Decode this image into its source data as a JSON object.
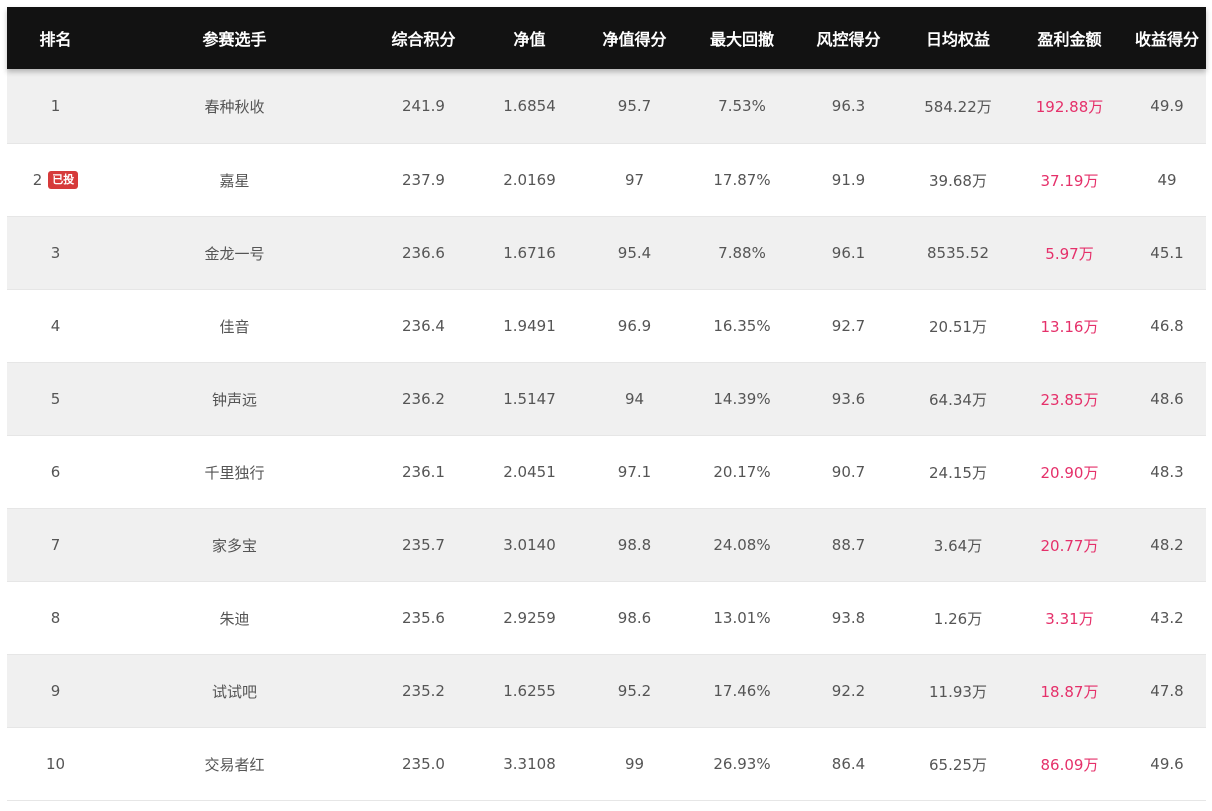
{
  "table": {
    "headers": {
      "rank": "排名",
      "name": "参赛选手",
      "score": "综合积分",
      "nav": "净值",
      "nav_score": "净值得分",
      "max_drawdown": "最大回撤",
      "risk_score": "风控得分",
      "daily_equity": "日均权益",
      "profit": "盈利金额",
      "return_score": "收益得分"
    },
    "rows": [
      {
        "rank": "1",
        "badge": "",
        "name": "春种秋收",
        "score": "241.9",
        "nav": "1.6854",
        "nav_score": "95.7",
        "max_drawdown": "7.53%",
        "risk_score": "96.3",
        "daily_equity": "584.22万",
        "profit": "192.88万",
        "return_score": "49.9"
      },
      {
        "rank": "2",
        "badge": "已投",
        "name": "嘉星",
        "score": "237.9",
        "nav": "2.0169",
        "nav_score": "97",
        "max_drawdown": "17.87%",
        "risk_score": "91.9",
        "daily_equity": "39.68万",
        "profit": "37.19万",
        "return_score": "49"
      },
      {
        "rank": "3",
        "badge": "",
        "name": "金龙一号",
        "score": "236.6",
        "nav": "1.6716",
        "nav_score": "95.4",
        "max_drawdown": "7.88%",
        "risk_score": "96.1",
        "daily_equity": "8535.52",
        "profit": "5.97万",
        "return_score": "45.1"
      },
      {
        "rank": "4",
        "badge": "",
        "name": "佳音",
        "score": "236.4",
        "nav": "1.9491",
        "nav_score": "96.9",
        "max_drawdown": "16.35%",
        "risk_score": "92.7",
        "daily_equity": "20.51万",
        "profit": "13.16万",
        "return_score": "46.8"
      },
      {
        "rank": "5",
        "badge": "",
        "name": "钟声远",
        "score": "236.2",
        "nav": "1.5147",
        "nav_score": "94",
        "max_drawdown": "14.39%",
        "risk_score": "93.6",
        "daily_equity": "64.34万",
        "profit": "23.85万",
        "return_score": "48.6"
      },
      {
        "rank": "6",
        "badge": "",
        "name": "千里独行",
        "score": "236.1",
        "nav": "2.0451",
        "nav_score": "97.1",
        "max_drawdown": "20.17%",
        "risk_score": "90.7",
        "daily_equity": "24.15万",
        "profit": "20.90万",
        "return_score": "48.3"
      },
      {
        "rank": "7",
        "badge": "",
        "name": "家多宝",
        "score": "235.7",
        "nav": "3.0140",
        "nav_score": "98.8",
        "max_drawdown": "24.08%",
        "risk_score": "88.7",
        "daily_equity": "3.64万",
        "profit": "20.77万",
        "return_score": "48.2"
      },
      {
        "rank": "8",
        "badge": "",
        "name": "朱迪",
        "score": "235.6",
        "nav": "2.9259",
        "nav_score": "98.6",
        "max_drawdown": "13.01%",
        "risk_score": "93.8",
        "daily_equity": "1.26万",
        "profit": "3.31万",
        "return_score": "43.2"
      },
      {
        "rank": "9",
        "badge": "",
        "name": "试试吧",
        "score": "235.2",
        "nav": "1.6255",
        "nav_score": "95.2",
        "max_drawdown": "17.46%",
        "risk_score": "92.2",
        "daily_equity": "11.93万",
        "profit": "18.87万",
        "return_score": "47.8"
      },
      {
        "rank": "10",
        "badge": "",
        "name": "交易者红",
        "score": "235.0",
        "nav": "3.3108",
        "nav_score": "99",
        "max_drawdown": "26.93%",
        "risk_score": "86.4",
        "daily_equity": "65.25万",
        "profit": "86.09万",
        "return_score": "49.6"
      }
    ]
  },
  "colors": {
    "header_bg": "#121212",
    "header_text": "#ffffff",
    "odd_row_bg": "#f0f0f0",
    "even_row_bg": "#ffffff",
    "body_text": "#555555",
    "profit_text": "#e5306a",
    "badge_bg": "#d63a3a"
  }
}
